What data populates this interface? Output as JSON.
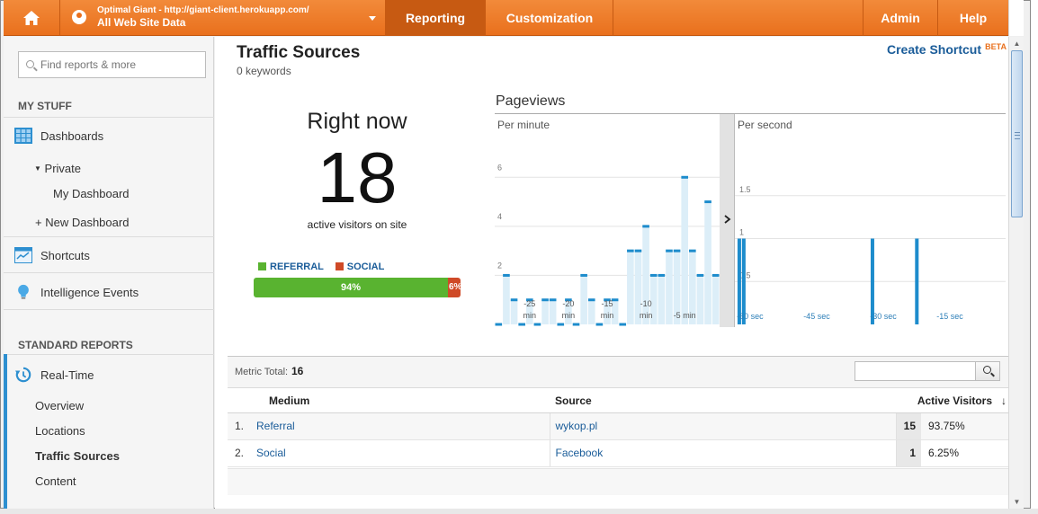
{
  "topbar": {
    "account_small": "Optimal Giant - http://giant-client.herokuapp.com/",
    "account_big": "All Web Site Data",
    "tabs": [
      {
        "label": "Reporting",
        "active": true
      },
      {
        "label": "Customization",
        "active": false
      },
      {
        "label": "Admin",
        "active": false
      },
      {
        "label": "Help",
        "active": false
      }
    ],
    "accent_color": "#e9701d"
  },
  "sidebar": {
    "search_placeholder": "Find reports & more",
    "my_stuff_heading": "MY STUFF",
    "items": {
      "dashboards": "Dashboards",
      "private": "Private",
      "my_dashboard": "My Dashboard",
      "new_dashboard": "+ New Dashboard",
      "shortcuts": "Shortcuts",
      "intelligence": "Intelligence Events"
    },
    "standard_heading": "STANDARD REPORTS",
    "realtime": "Real-Time",
    "realtime_sub": [
      "Overview",
      "Locations",
      "Traffic Sources",
      "Content"
    ],
    "active_sub": "Traffic Sources"
  },
  "main": {
    "title": "Traffic Sources",
    "subtitle": "0 keywords",
    "create_shortcut": "Create Shortcut",
    "beta": "BETA",
    "right_now": {
      "title": "Right now",
      "count": "18",
      "caption": "active visitors on site"
    },
    "legend": [
      {
        "name": "REFERRAL",
        "color": "#59b330"
      },
      {
        "name": "SOCIAL",
        "color": "#cf4a27"
      }
    ],
    "mix": {
      "referral_pct": 94,
      "social_pct": 6,
      "referral_label": "94%",
      "social_label": "6%"
    },
    "pageviews_title": "Pageviews",
    "per_minute_label": "Per minute",
    "per_second_label": "Per second"
  },
  "chart_data": [
    {
      "type": "bar",
      "title": "Per minute",
      "ylim": [
        0,
        7
      ],
      "yticks": [
        2,
        4,
        6
      ],
      "xtick_labels": [
        "-25 min",
        "-20 min",
        "-15 min",
        "-10 min",
        "-5 min"
      ],
      "x": [
        -29,
        -28,
        -27,
        -26,
        -25,
        -24,
        -23,
        -22,
        -21,
        -20,
        -19,
        -18,
        -17,
        -16,
        -15,
        -14,
        -13,
        -12,
        -11,
        -10,
        -9,
        -8,
        -7,
        -6,
        -5,
        -4,
        -3,
        -2,
        -1
      ],
      "values": [
        0,
        2,
        1,
        0,
        1,
        0,
        1,
        1,
        0,
        1,
        0,
        2,
        1,
        0,
        1,
        1,
        0,
        3,
        3,
        4,
        2,
        2,
        3,
        3,
        6,
        3,
        2,
        5,
        2
      ]
    },
    {
      "type": "bar",
      "title": "Per second",
      "ylim": [
        0,
        2
      ],
      "yticks": [
        0.5,
        1,
        1.5
      ],
      "xtick_labels": [
        "-60 sec",
        "-45 sec",
        "-30 sec",
        "-15 sec"
      ],
      "x": [
        -60,
        -59,
        -30,
        -20
      ],
      "values": [
        1,
        1,
        1,
        1
      ]
    }
  ],
  "table": {
    "metric_total_label": "Metric Total:",
    "metric_total_value": "16",
    "columns": [
      "Medium",
      "Source",
      "Active Visitors"
    ],
    "rows": [
      {
        "idx": "1.",
        "medium": "Referral",
        "source": "wykop.pl",
        "value": "15",
        "pct": "93.75%"
      },
      {
        "idx": "2.",
        "medium": "Social",
        "source": "Facebook",
        "value": "1",
        "pct": "6.25%"
      }
    ]
  }
}
